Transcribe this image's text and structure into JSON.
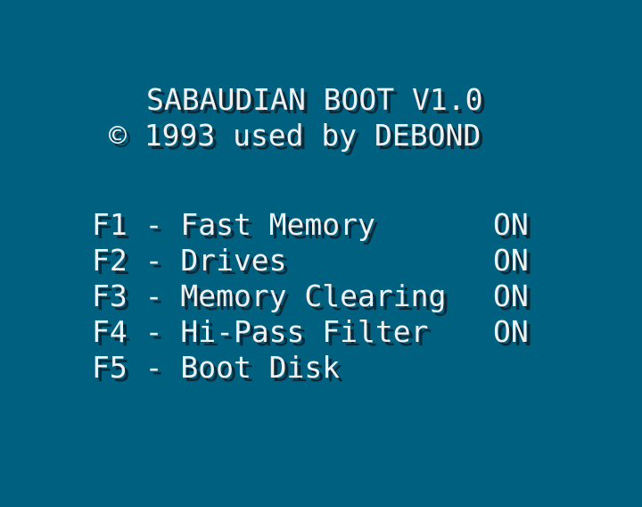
{
  "header": {
    "title": "SABAUDIAN BOOT V1.0",
    "copyright": "© 1993 used by DEBOND"
  },
  "menu": {
    "items": [
      {
        "label": "F1 - Fast Memory",
        "state": "ON"
      },
      {
        "label": "F2 - Drives",
        "state": "ON"
      },
      {
        "label": "F3 - Memory Clearing",
        "state": "ON"
      },
      {
        "label": "F4 - Hi-Pass Filter",
        "state": "ON"
      },
      {
        "label": "F5 - Boot Disk",
        "state": ""
      }
    ]
  },
  "colors": {
    "background": "#006080",
    "text": "#f0f0f0",
    "shadow": "#0a2a3a"
  }
}
